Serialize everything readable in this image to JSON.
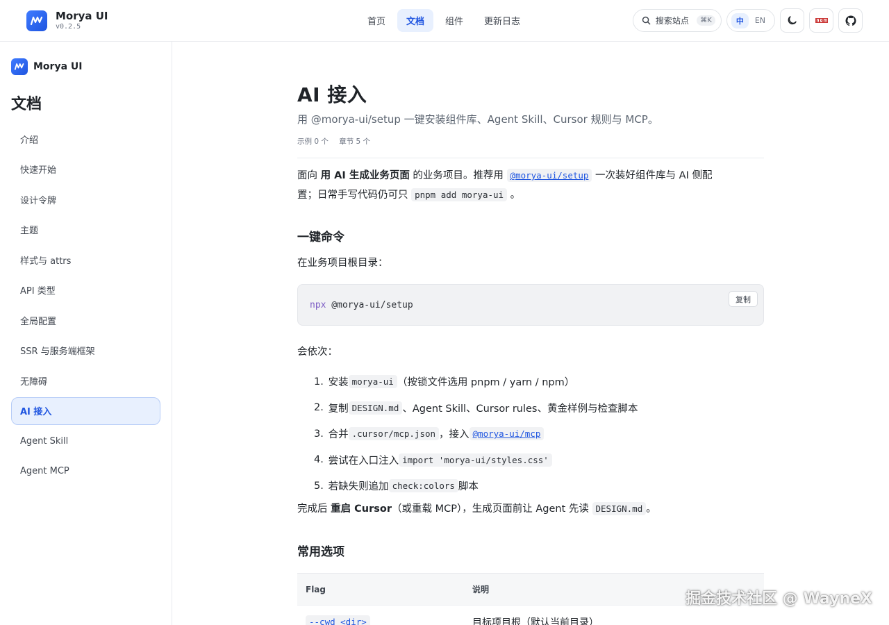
{
  "header": {
    "brand_name": "Morya UI",
    "version": "v0.2.5",
    "nav": [
      "首页",
      "文档",
      "组件",
      "更新日志"
    ],
    "search_label": "搜索站点",
    "search_kbd": "⌘K",
    "lang_zh": "中",
    "lang_en": "EN"
  },
  "sidebar": {
    "brand_name": "Morya UI",
    "title": "文档",
    "items": [
      "介绍",
      "快速开始",
      "设计令牌",
      "主题",
      "样式与 attrs",
      "API 类型",
      "全局配置",
      "SSR 与服务端框架",
      "无障碍",
      "AI 接入",
      "Agent Skill",
      "Agent MCP"
    ],
    "active_index": 9
  },
  "main": {
    "title": "AI 接入",
    "subtitle": "用 @morya-ui/setup 一键安装组件库、Agent Skill、Cursor 规则与 MCP。",
    "meta_examples": "示例 0 个",
    "meta_sections": "章节 5 个",
    "intro": {
      "t1": "面向 ",
      "b1": "用 AI 生成业务页面",
      "t2": " 的业务项目。推荐用 ",
      "c1": "@morya-ui/setup",
      "t3": " 一次装好组件库与 AI 侧配",
      "t4": "置；日常手写代码仍可只 ",
      "c2": "pnpm add morya-ui",
      "t5": " 。"
    },
    "h_cmd": "一键命令",
    "cmd_desc": "在业务项目根目录：",
    "code": {
      "kw": "npx",
      "rest": " @morya-ui/setup",
      "copy": "复制"
    },
    "steps_intro": "会依次：",
    "steps": [
      {
        "num": "1.",
        "a": "安装 ",
        "code": "morya-ui",
        "b": "（按锁文件选用 pnpm / yarn / npm）"
      },
      {
        "num": "2.",
        "a": "复制 ",
        "code": "DESIGN.md",
        "b": "、Agent Skill、Cursor rules、黄金样例与检查脚本"
      },
      {
        "num": "3.",
        "a": "合并 ",
        "code": ".cursor/mcp.json",
        "b": "，接入 ",
        "code2": "@morya-ui/mcp"
      },
      {
        "num": "4.",
        "a": "尝试在入口注入 ",
        "code": "import 'morya-ui/styles.css'",
        "b": ""
      },
      {
        "num": "5.",
        "a": "若缺失则追加 ",
        "code": "check:colors",
        "b": " 脚本"
      }
    ],
    "after": {
      "t1": "完成后 ",
      "b1": "重启 Cursor",
      "t2": "（或重载 MCP），生成页面前让 Agent 先读 ",
      "c1": "DESIGN.md",
      "t3": "。"
    },
    "h_opts": "常用选项",
    "table": {
      "headers": [
        "Flag",
        "说明"
      ],
      "rows": [
        {
          "flag": "--cwd <dir>",
          "desc": "目标项目根（默认当前目录）"
        }
      ]
    }
  },
  "watermark": "掘金技术社区 @ WayneX"
}
